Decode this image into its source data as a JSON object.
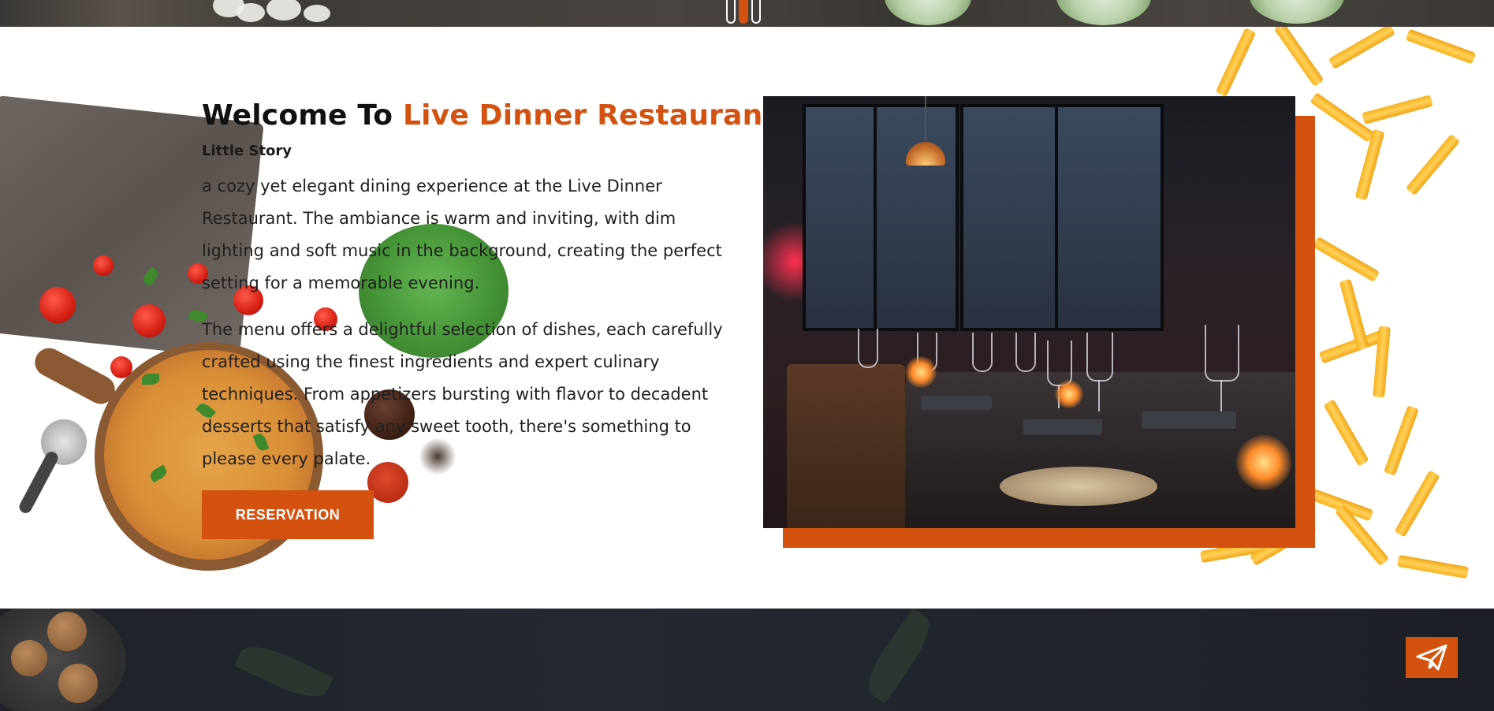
{
  "slider": {
    "dots": 3,
    "active_index": 1
  },
  "about": {
    "title_prefix": "Welcome To ",
    "title_accent": "Live Dinner Restaurant",
    "subtitle": "Little Story",
    "paragraph_1": "a cozy yet elegant dining experience at the Live Dinner Restaurant. The ambiance is warm and inviting, with dim lighting and soft music in the background, creating the perfect setting for a memorable evening.",
    "paragraph_2": "The menu offers a delightful selection of dishes, each carefully crafted using the finest ingredients and expert culinary techniques. From appetizers bursting with flavor to decadent desserts that satisfy any sweet tooth, there's something to please every palate.",
    "button_label": "RESERVATION"
  },
  "icons": {
    "send": "paper-plane-icon"
  },
  "colors": {
    "accent": "#d4520f",
    "dark_band": "#1e2228"
  }
}
